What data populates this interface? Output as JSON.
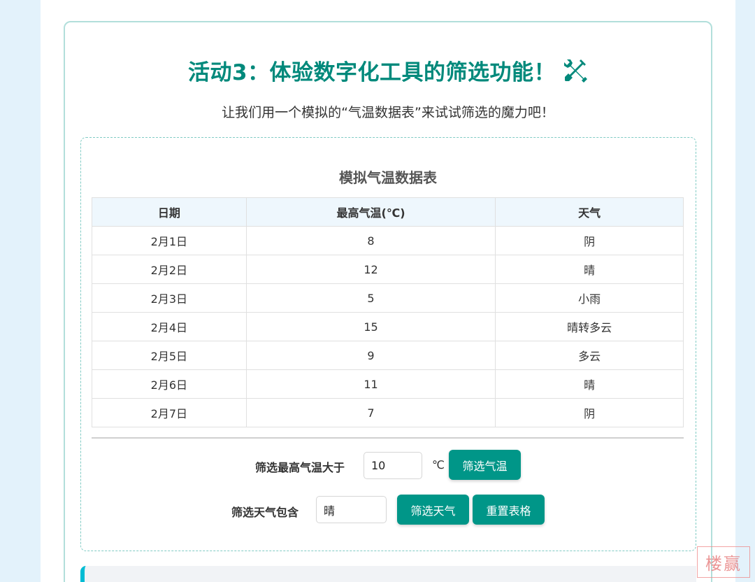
{
  "activity": {
    "title": "活动3：体验数字化工具的筛选功能！",
    "title_icon": "wrench-screwdriver-icon",
    "subtitle": "让我们用一个模拟的“气温数据表”来试试筛选的魔力吧！"
  },
  "table": {
    "title": "模拟气温数据表",
    "headers": [
      "日期",
      "最高气温(℃)",
      "天气"
    ],
    "rows": [
      [
        "2月1日",
        "8",
        "阴"
      ],
      [
        "2月2日",
        "12",
        "晴"
      ],
      [
        "2月3日",
        "5",
        "小雨"
      ],
      [
        "2月4日",
        "15",
        "晴转多云"
      ],
      [
        "2月5日",
        "9",
        "多云"
      ],
      [
        "2月6日",
        "11",
        "晴"
      ],
      [
        "2月7日",
        "7",
        "阴"
      ]
    ]
  },
  "filters": {
    "temp_label": "筛选最高气温大于",
    "temp_value": "10",
    "temp_unit": "℃",
    "temp_button": "筛选气温",
    "weather_label": "筛选天气包含",
    "weather_value": "晴",
    "weather_button": "筛选天气",
    "reset_button": "重置表格"
  },
  "watermark": "楼赢",
  "colors": {
    "accent": "#009688",
    "title": "#00897b",
    "background": "#e3f2fb"
  }
}
